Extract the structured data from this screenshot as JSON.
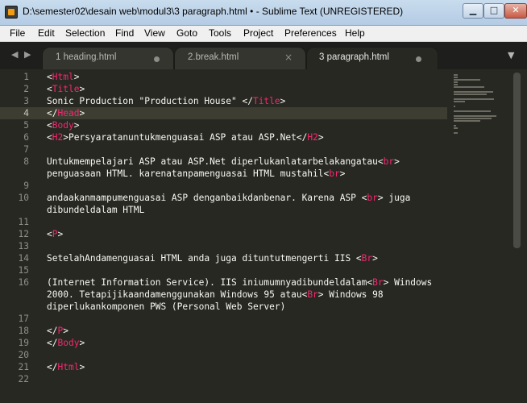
{
  "window": {
    "title": "D:\\semester02\\desain web\\modul3\\3 paragraph.html • - Sublime Text (UNREGISTERED)",
    "minimize_glyph": "▁",
    "maximize_glyph": "□",
    "close_glyph": "✕"
  },
  "menu": [
    "File",
    "Edit",
    "Selection",
    "Find",
    "View",
    "Goto",
    "Tools",
    "Project",
    "Preferences",
    "Help"
  ],
  "tabs": [
    {
      "label": "1 heading.html",
      "state": "dirty",
      "active": false
    },
    {
      "label": "2.break.html",
      "state": "close",
      "close_glyph": "×",
      "active": false
    },
    {
      "label": "3 paragraph.html",
      "state": "dirty",
      "active": true
    }
  ],
  "tab_nav": {
    "left": "◀",
    "right": "▶",
    "menu": "▼"
  },
  "editor": {
    "current_line": 4,
    "colors": {
      "tag": "#f92672",
      "text": "#f8f8f2",
      "background": "#272822",
      "line_number": "#8f908a"
    },
    "lines": [
      {
        "n": "1",
        "segs": [
          {
            "t": "<",
            "k": "pun"
          },
          {
            "t": "Html",
            "k": "tag"
          },
          {
            "t": ">",
            "k": "pun"
          }
        ]
      },
      {
        "n": "2",
        "segs": [
          {
            "t": "<",
            "k": "pun"
          },
          {
            "t": "Title",
            "k": "tag"
          },
          {
            "t": ">",
            "k": "pun"
          }
        ]
      },
      {
        "n": "3",
        "segs": [
          {
            "t": "Sonic Production \"Production House\" </",
            "k": "pun"
          },
          {
            "t": "Title",
            "k": "tag"
          },
          {
            "t": ">",
            "k": "pun"
          }
        ]
      },
      {
        "n": "4",
        "segs": [
          {
            "t": "</",
            "k": "pun"
          },
          {
            "t": "Head",
            "k": "tag"
          },
          {
            "t": ">",
            "k": "pun"
          }
        ]
      },
      {
        "n": "5",
        "segs": [
          {
            "t": "<",
            "k": "pun"
          },
          {
            "t": "Body",
            "k": "tag"
          },
          {
            "t": ">",
            "k": "pun"
          }
        ]
      },
      {
        "n": "6",
        "segs": [
          {
            "t": "<",
            "k": "pun"
          },
          {
            "t": "H2",
            "k": "tag"
          },
          {
            "t": ">Persyaratanuntukmenguasai ASP atau ASP.Net</",
            "k": "pun"
          },
          {
            "t": "H2",
            "k": "tag"
          },
          {
            "t": ">",
            "k": "pun"
          }
        ]
      },
      {
        "n": "7",
        "segs": []
      },
      {
        "n": "8",
        "segs": [
          {
            "t": "Untukmempelajari ASP atau ASP.Net diperlukanlatarbelakangatau<",
            "k": "pun"
          },
          {
            "t": "br",
            "k": "tag"
          },
          {
            "t": ">",
            "k": "pun"
          }
        ]
      },
      {
        "n": "",
        "segs": [
          {
            "t": "penguasaan HTML. karenatanpamenguasai HTML mustahil<",
            "k": "pun"
          },
          {
            "t": "br",
            "k": "tag"
          },
          {
            "t": ">",
            "k": "pun"
          }
        ]
      },
      {
        "n": "9",
        "segs": []
      },
      {
        "n": "10",
        "segs": [
          {
            "t": "andaakanmampumenguasai ASP denganbaikdanbenar. Karena ASP <",
            "k": "pun"
          },
          {
            "t": "br",
            "k": "tag"
          },
          {
            "t": "> juga",
            "k": "pun"
          }
        ]
      },
      {
        "n": "",
        "segs": [
          {
            "t": "dibundeldalam HTML",
            "k": "pun"
          }
        ]
      },
      {
        "n": "11",
        "segs": []
      },
      {
        "n": "12",
        "segs": [
          {
            "t": "<",
            "k": "pun"
          },
          {
            "t": "P",
            "k": "tag"
          },
          {
            "t": ">",
            "k": "pun"
          }
        ]
      },
      {
        "n": "13",
        "segs": []
      },
      {
        "n": "14",
        "segs": [
          {
            "t": "SetelahAndamenguasai HTML anda juga dituntutmengerti IIS <",
            "k": "pun"
          },
          {
            "t": "Br",
            "k": "tag"
          },
          {
            "t": ">",
            "k": "pun"
          }
        ]
      },
      {
        "n": "15",
        "segs": []
      },
      {
        "n": "16",
        "segs": [
          {
            "t": "(Internet Information Service). IIS iniumumnyadibundeldalam<",
            "k": "pun"
          },
          {
            "t": "Br",
            "k": "tag"
          },
          {
            "t": "> Windows",
            "k": "pun"
          }
        ]
      },
      {
        "n": "",
        "segs": [
          {
            "t": "2000. Tetapijikaandamenggunakan Windows 95 atau<",
            "k": "pun"
          },
          {
            "t": "Br",
            "k": "tag"
          },
          {
            "t": "> Windows 98",
            "k": "pun"
          }
        ]
      },
      {
        "n": "",
        "segs": [
          {
            "t": "diperlukankomponen PWS (Personal Web Server)",
            "k": "pun"
          }
        ]
      },
      {
        "n": "17",
        "segs": []
      },
      {
        "n": "18",
        "segs": [
          {
            "t": "</",
            "k": "pun"
          },
          {
            "t": "P",
            "k": "tag"
          },
          {
            "t": ">",
            "k": "pun"
          }
        ]
      },
      {
        "n": "19",
        "segs": [
          {
            "t": "</",
            "k": "pun"
          },
          {
            "t": "Body",
            "k": "tag"
          },
          {
            "t": ">",
            "k": "pun"
          }
        ]
      },
      {
        "n": "20",
        "segs": []
      },
      {
        "n": "21",
        "segs": [
          {
            "t": "</",
            "k": "pun"
          },
          {
            "t": "Html",
            "k": "tag"
          },
          {
            "t": ">",
            "k": "pun"
          }
        ]
      },
      {
        "n": "22",
        "segs": []
      }
    ]
  }
}
